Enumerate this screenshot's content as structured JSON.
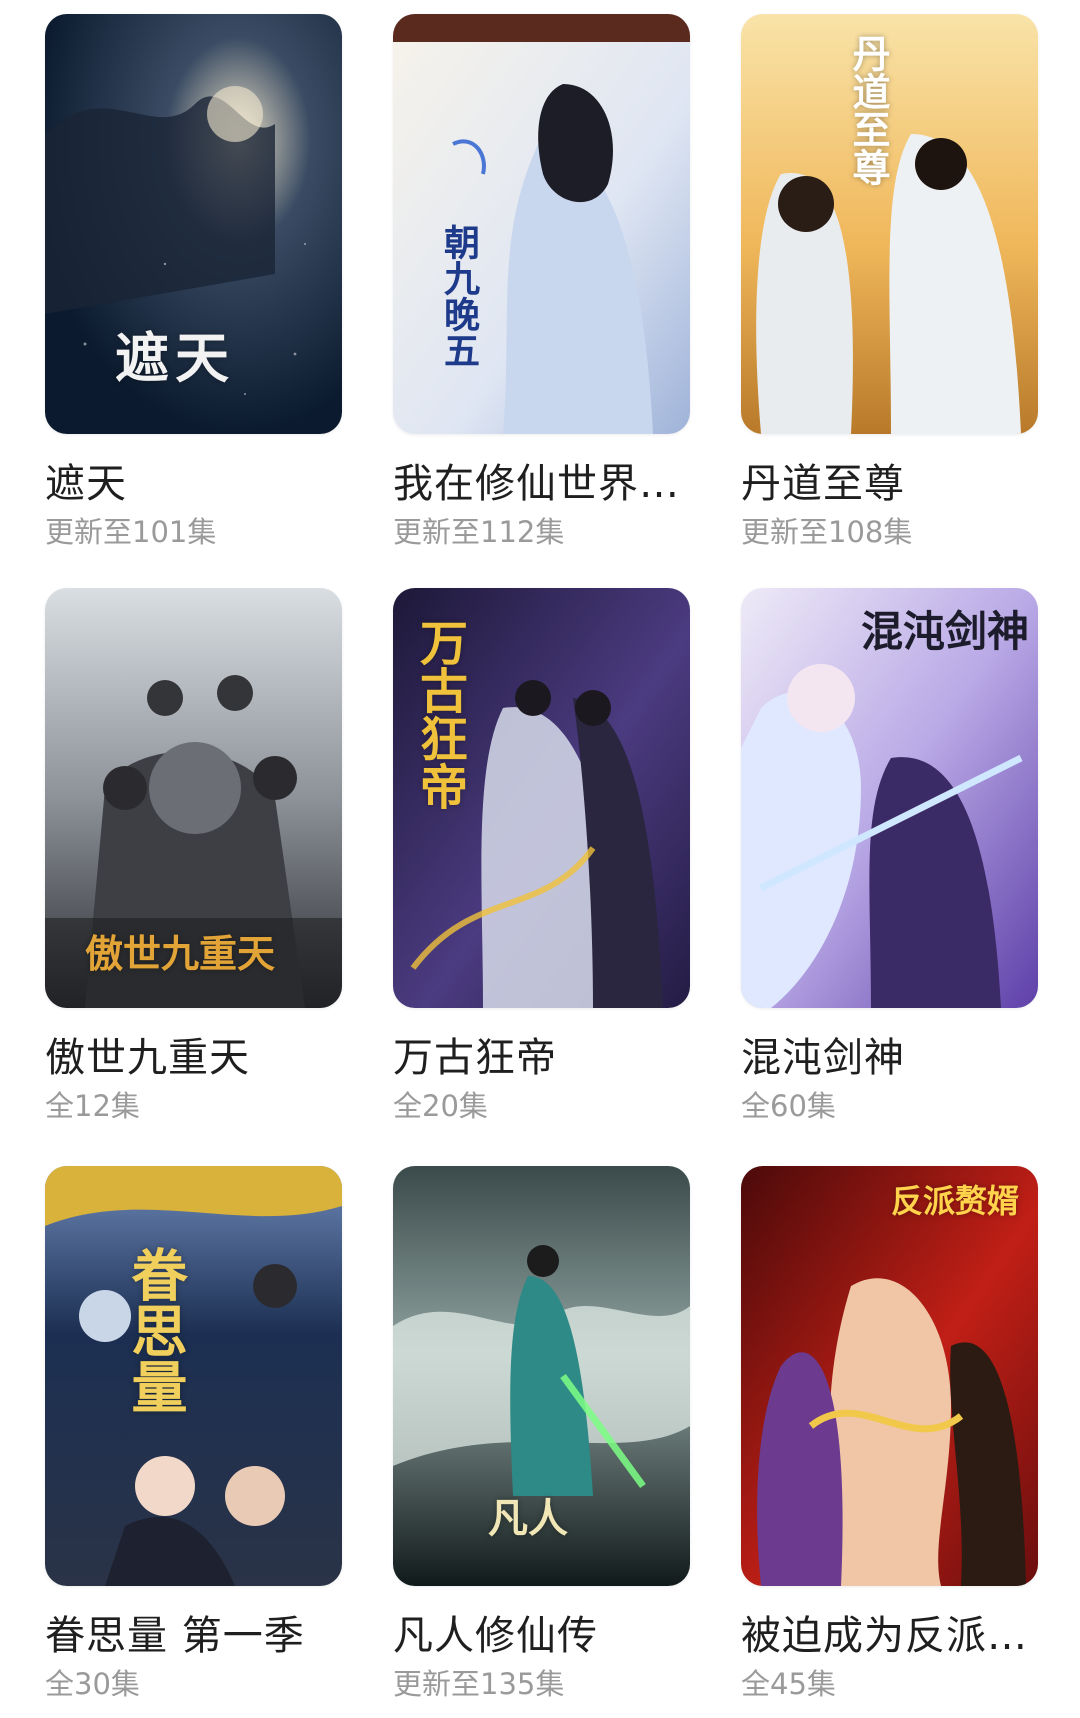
{
  "items": [
    {
      "title": "遮天",
      "subtitle": "更新至101集",
      "poster_text": "遮天",
      "colors": [
        "#0b1a2e",
        "#3a4b63",
        "#d9c79a"
      ]
    },
    {
      "title": "我在修仙世界…",
      "subtitle": "更新至112集",
      "poster_text": "朝九晚五",
      "colors": [
        "#f3f0ea",
        "#b9c9e8",
        "#1e3a8a"
      ]
    },
    {
      "title": "丹道至尊",
      "subtitle": "更新至108集",
      "poster_text": "丹道至尊",
      "colors": [
        "#f6d58a",
        "#e9a43b",
        "#ffffff"
      ]
    },
    {
      "title": "傲世九重天",
      "subtitle": "全12集",
      "poster_text": "傲世九重天",
      "colors": [
        "#cfd6dc",
        "#3d3f44",
        "#d79a2a"
      ]
    },
    {
      "title": "万古狂帝",
      "subtitle": "全20集",
      "poster_text": "万古狂帝",
      "colors": [
        "#2b2350",
        "#6a4fa0",
        "#f0c13a"
      ]
    },
    {
      "title": "混沌剑神",
      "subtitle": "全60集",
      "poster_text": "混沌剑神",
      "colors": [
        "#d8d6ef",
        "#8b6fd0",
        "#2a2a4a"
      ]
    },
    {
      "title": "眷思量 第一季",
      "subtitle": "全30集",
      "poster_text": "眷思量",
      "colors": [
        "#1c2f52",
        "#d8b23a",
        "#6d88b8"
      ]
    },
    {
      "title": "凡人修仙传",
      "subtitle": "更新至135集",
      "poster_text": "凡人",
      "colors": [
        "#1b2a2a",
        "#4a8a86",
        "#e7d9a8"
      ]
    },
    {
      "title": "被迫成为反派…",
      "subtitle": "全45集",
      "poster_text": "反派赘婿",
      "colors": [
        "#7a0d0d",
        "#d22a1e",
        "#f1c84a"
      ]
    }
  ]
}
